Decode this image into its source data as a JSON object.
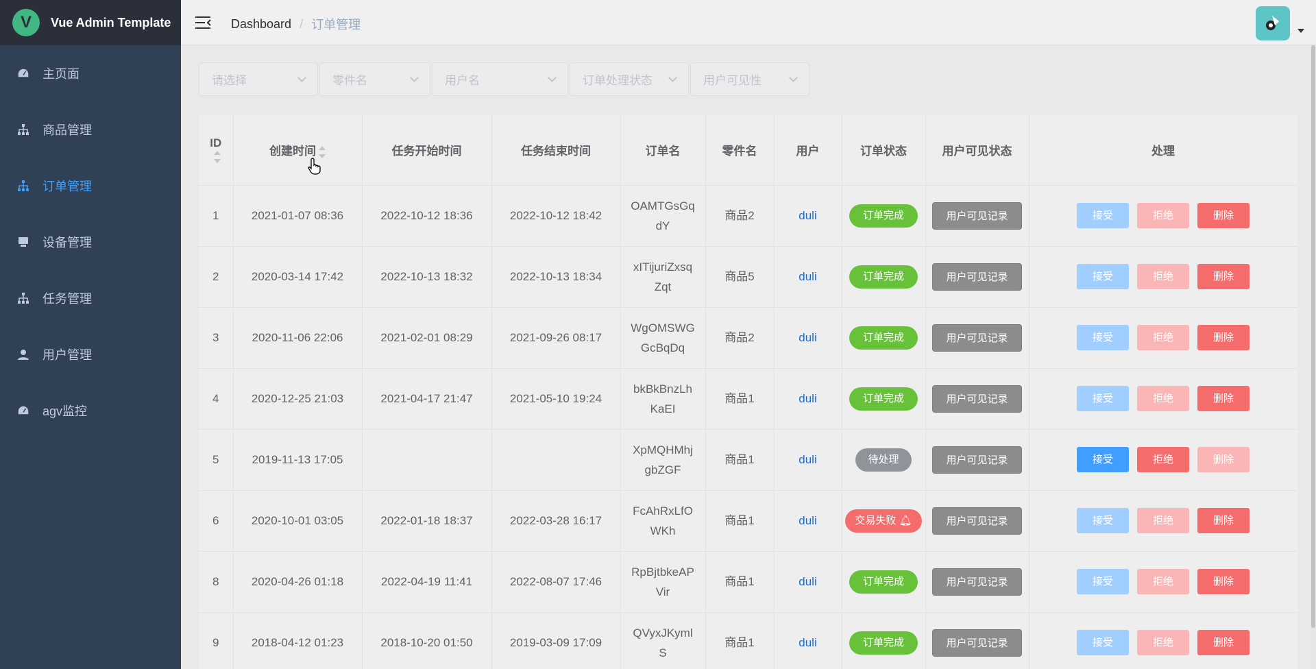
{
  "app": {
    "title": "Vue Admin Template",
    "logo_letter": "V"
  },
  "sidebar": {
    "items": [
      {
        "label": "主页面",
        "icon": "dashboard-icon",
        "active": false
      },
      {
        "label": "商品管理",
        "icon": "tree-icon",
        "active": false
      },
      {
        "label": "订单管理",
        "icon": "tree-icon",
        "active": true
      },
      {
        "label": "设备管理",
        "icon": "device-icon",
        "active": false
      },
      {
        "label": "任务管理",
        "icon": "tree-icon",
        "active": false
      },
      {
        "label": "用户管理",
        "icon": "user-icon",
        "active": false
      },
      {
        "label": "agv监控",
        "icon": "dashboard-icon",
        "active": false
      }
    ]
  },
  "breadcrumb": {
    "home": "Dashboard",
    "separator": "/",
    "current": "订单管理"
  },
  "filters": [
    {
      "placeholder": "请选择"
    },
    {
      "placeholder": "零件名"
    },
    {
      "placeholder": "用户名"
    },
    {
      "placeholder": "订单处理状态"
    },
    {
      "placeholder": "用户可见性"
    }
  ],
  "table": {
    "headers": {
      "id": "ID",
      "created": "创建时间",
      "start": "任务开始时间",
      "end": "任务结束时间",
      "order": "订单名",
      "part": "零件名",
      "user": "用户",
      "status": "订单状态",
      "visible": "用户可见状态",
      "action": "处理"
    },
    "visible_button": "用户可见记录",
    "actions": {
      "accept": "接受",
      "reject": "拒绝",
      "delete": "删除"
    },
    "rows": [
      {
        "id": "1",
        "created": "2021-01-07 08:36",
        "start": "2022-10-12 18:36",
        "end": "2022-10-12 18:42",
        "order1": "OAMTGsGq",
        "order2": "dY",
        "part": "商品2",
        "user": "duli",
        "status": "订单完成"
      },
      {
        "id": "2",
        "created": "2020-03-14 17:42",
        "start": "2022-10-13 18:32",
        "end": "2022-10-13 18:34",
        "order1": "xITijuriZxsq",
        "order2": "Zqt",
        "part": "商品5",
        "user": "duli",
        "status": "订单完成"
      },
      {
        "id": "3",
        "created": "2020-11-06 22:06",
        "start": "2021-02-01 08:29",
        "end": "2021-09-26 08:17",
        "order1": "WgOMSWG",
        "order2": "GcBqDq",
        "part": "商品2",
        "user": "duli",
        "status": "订单完成"
      },
      {
        "id": "4",
        "created": "2020-12-25 21:03",
        "start": "2021-04-17 21:47",
        "end": "2021-05-10 19:24",
        "order1": "bkBkBnzLh",
        "order2": "KaEI",
        "part": "商品1",
        "user": "duli",
        "status": "订单完成"
      },
      {
        "id": "5",
        "created": "2019-11-13 17:05",
        "start": "",
        "end": "",
        "order1": "XpMQHMhj",
        "order2": "gbZGF",
        "part": "商品1",
        "user": "duli",
        "status": "待处理"
      },
      {
        "id": "6",
        "created": "2020-10-01 03:05",
        "start": "2022-01-18 18:37",
        "end": "2022-03-28 16:17",
        "order1": "FcAhRxLfO",
        "order2": "WKh",
        "part": "商品1",
        "user": "duli",
        "status": "交易失败"
      },
      {
        "id": "8",
        "created": "2020-04-26 01:18",
        "start": "2022-04-19 11:41",
        "end": "2022-08-07 17:46",
        "order1": "RpBjtbkeAP",
        "order2": "Vir",
        "part": "商品1",
        "user": "duli",
        "status": "订单完成"
      },
      {
        "id": "9",
        "created": "2018-04-12 01:23",
        "start": "2018-10-20 01:50",
        "end": "2019-03-09 17:09",
        "order1": "QVyxJKyml",
        "order2": "S",
        "part": "商品1",
        "user": "duli",
        "status": "订单完成"
      }
    ]
  }
}
